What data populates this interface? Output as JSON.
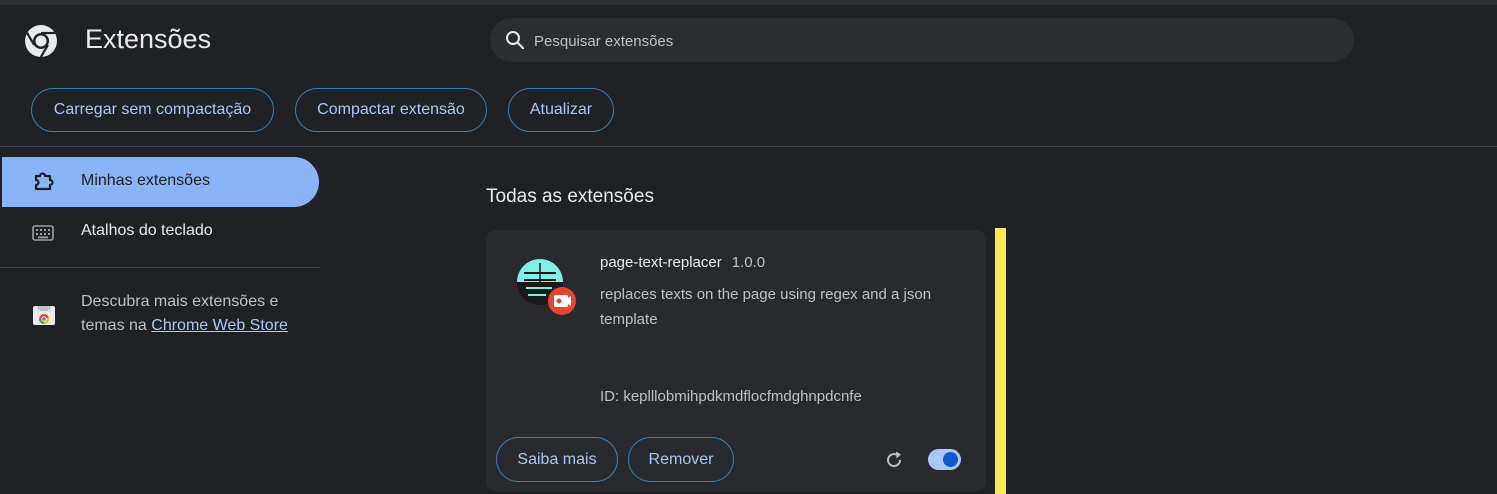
{
  "header": {
    "title": "Extensões",
    "logo_icon": "chrome-icon",
    "search": {
      "placeholder": "Pesquisar extensões",
      "value": ""
    }
  },
  "toolbar": {
    "load_unpacked_label": "Carregar sem compactação",
    "pack_label": "Compactar extensão",
    "update_label": "Atualizar",
    "accent_color": "#a8c7fa"
  },
  "sidebar": {
    "items": [
      {
        "label": "Minhas extensões",
        "icon": "puzzle-icon",
        "active": true
      },
      {
        "label": "Atalhos do teclado",
        "icon": "keyboard-icon",
        "active": false
      }
    ],
    "promo_text": "Descubra mais extensões e temas na",
    "promo_link": "Chrome Web Store",
    "promo_icon": "web-store-icon",
    "active_color": "#8ab4f8"
  },
  "main": {
    "section_title": "Todas as extensões",
    "extension": {
      "name": "page-text-replacer",
      "version": "1.0.0",
      "description": "replaces texts on the page using regex and a json template",
      "id_text": "ID: keplllobmihpdkmdflocfmdghnpdcnfe",
      "details_label": "Saiba mais",
      "remove_label": "Remover",
      "enabled": true,
      "icon": "extension-icon",
      "badge_icon": "unpacked-badge-icon"
    }
  }
}
